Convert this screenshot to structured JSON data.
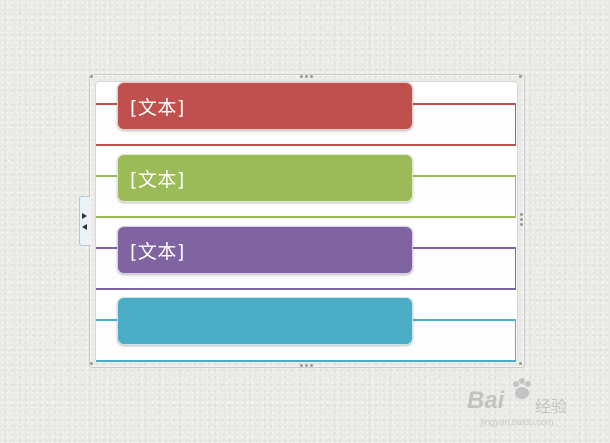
{
  "diagram": {
    "items": [
      {
        "label": "[文本]",
        "color": "#c0504d"
      },
      {
        "label": "[文本]",
        "color": "#9bbb59"
      },
      {
        "label": "[文本]",
        "color": "#8064a2"
      },
      {
        "label": "",
        "color": "#4bacc6"
      }
    ]
  },
  "side_tab": {
    "icons": [
      "expand-right-arrow-icon",
      "collapse-left-arrow-icon"
    ]
  },
  "watermark": {
    "brand": "Bai",
    "suffix": "经验",
    "url": "jingyan.baidu.com"
  }
}
